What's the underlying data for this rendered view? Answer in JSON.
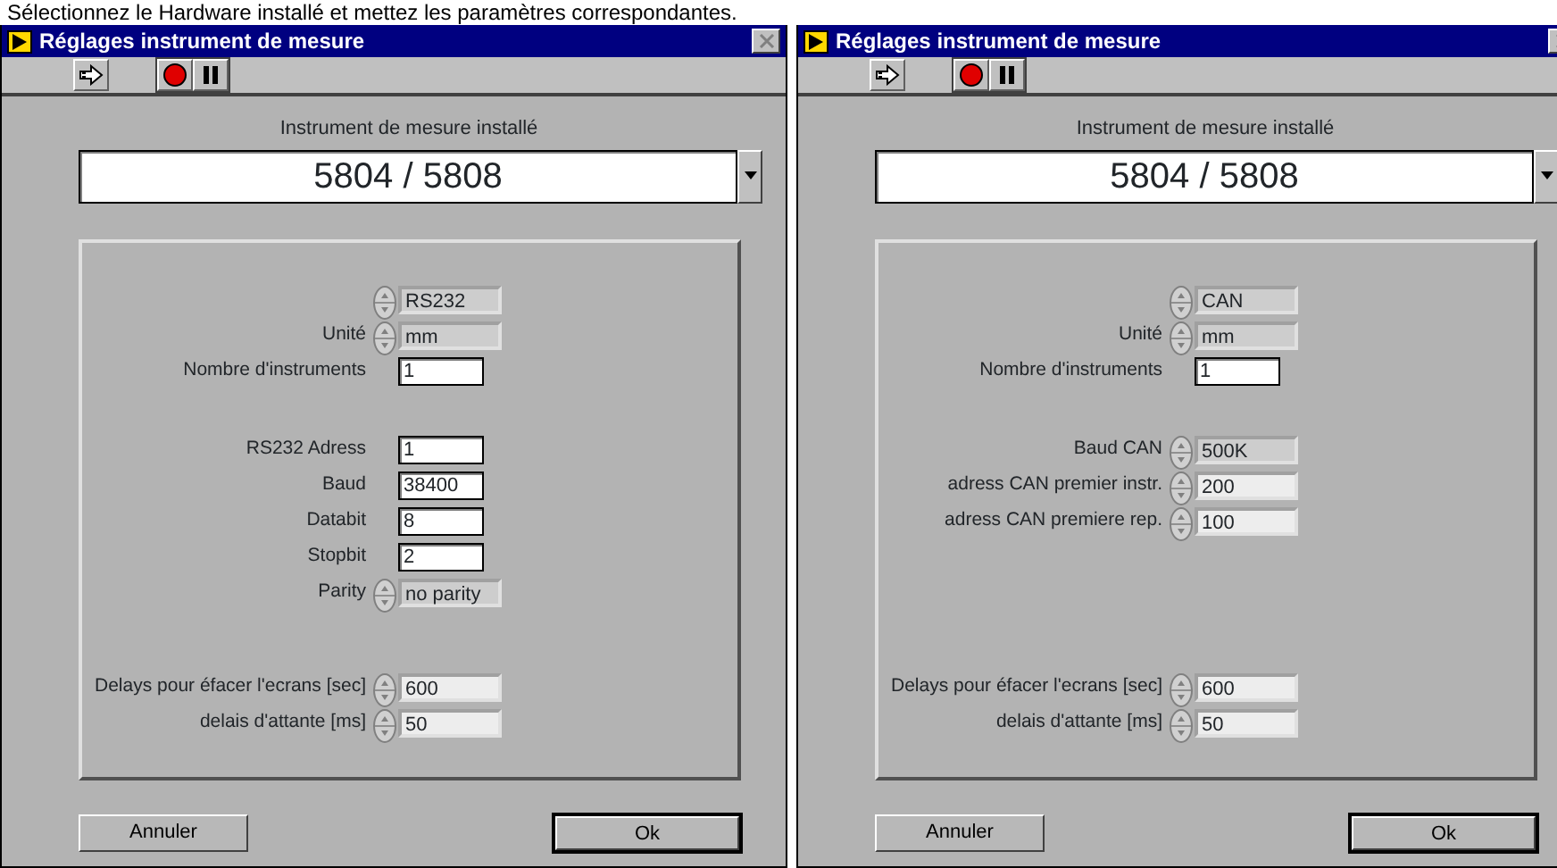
{
  "caption": "Sélectionnez le Hardware installé et mettez les paramètres correspondantes.",
  "windows": [
    {
      "title": "Réglages instrument de mesure",
      "instrument": {
        "label": "Instrument de mesure installé",
        "value": "5804 / 5808"
      },
      "sections": [
        [
          {
            "kind": "ring",
            "value": "RS232"
          },
          {
            "kind": "ring",
            "label": "Unité",
            "value": "mm"
          },
          {
            "kind": "input",
            "label": "Nombre d'instruments",
            "value": "1"
          }
        ],
        [
          {
            "kind": "input",
            "label": "RS232 Adress",
            "value": "1"
          },
          {
            "kind": "input",
            "label": "Baud",
            "value": "38400"
          },
          {
            "kind": "input",
            "label": "Databit",
            "value": "8"
          },
          {
            "kind": "input",
            "label": "Stopbit",
            "value": "2"
          },
          {
            "kind": "ring",
            "label": "Parity",
            "value": "no parity"
          }
        ],
        [
          {
            "kind": "numeric",
            "label": "Delays pour éfacer l'ecrans [sec]",
            "value": "600"
          },
          {
            "kind": "numeric",
            "label": "delais d'attante [ms]",
            "value": "50"
          }
        ]
      ],
      "buttons": [
        {
          "label": "Annuler",
          "default": false
        },
        {
          "label": "Ok",
          "default": true
        }
      ]
    },
    {
      "title": "Réglages instrument de mesure",
      "instrument": {
        "label": "Instrument de mesure installé",
        "value": "5804 / 5808"
      },
      "sections": [
        [
          {
            "kind": "ring",
            "value": "CAN"
          },
          {
            "kind": "ring",
            "label": "Unité",
            "value": "mm"
          },
          {
            "kind": "input",
            "label": "Nombre d'instruments",
            "value": "1"
          }
        ],
        [
          {
            "kind": "ring",
            "label": "Baud CAN",
            "value": "500K"
          },
          {
            "kind": "numeric",
            "label": "adress CAN premier instr.",
            "value": "200"
          },
          {
            "kind": "numeric",
            "label": "adress CAN premiere rep.",
            "value": "100"
          }
        ],
        [
          {
            "kind": "numeric",
            "label": "Delays pour éfacer l'ecrans [sec]",
            "value": "600"
          },
          {
            "kind": "numeric",
            "label": "delais d'attante [ms]",
            "value": "50"
          }
        ]
      ],
      "buttons": [
        {
          "label": "Annuler",
          "default": false
        },
        {
          "label": "Ok",
          "default": true
        }
      ]
    }
  ]
}
